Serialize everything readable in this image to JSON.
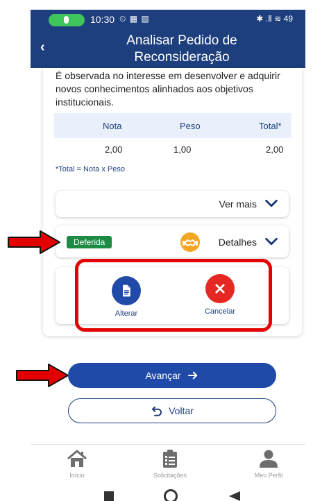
{
  "status_bar": {
    "time": "10:30",
    "left_icons": "⏲ ▦ ▧",
    "right_icons": "✱ .Ⅱ ≋ 49"
  },
  "header": {
    "back": "‹",
    "title_line1": "Analisar Pedido de",
    "title_line2": "Reconsideração"
  },
  "criterion": {
    "description": "É observada no interesse em desenvolver e adquirir novos conhecimentos alinhados aos objetivos institucionais."
  },
  "score_table": {
    "headers": [
      "Nota",
      "Peso",
      "Total*"
    ],
    "values": [
      "2,00",
      "1,00",
      "2,00"
    ],
    "footnote": "*Total = Nota x Peso"
  },
  "ver_mais": {
    "label": "Ver mais"
  },
  "status_section": {
    "badge": "Deferida",
    "details_label": "Detalhes"
  },
  "actions": {
    "alterar": "Alterar",
    "cancelar": "Cancelar"
  },
  "buttons": {
    "avancar": "Avançar",
    "voltar": "Voltar"
  },
  "bottom_nav": [
    {
      "label": "Início"
    },
    {
      "label": "Solicitações"
    },
    {
      "label": "Meu Perfil"
    }
  ],
  "colors": {
    "brand_navy": "#1e3f7d",
    "primary_button": "#1f4aa8",
    "success_badge": "#1e8a44",
    "cancel_red": "#e52821",
    "annotation_red": "#e30000",
    "handshake_orange": "#f2a623"
  }
}
